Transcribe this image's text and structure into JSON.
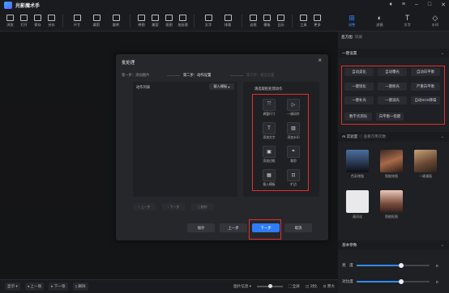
{
  "app": {
    "title": "光影魔术手"
  },
  "toolbar": {
    "items": [
      {
        "icon": "browse-icon",
        "label": "浏览"
      },
      {
        "icon": "open-icon",
        "label": "打开"
      },
      {
        "icon": "save-icon",
        "label": "保存"
      },
      {
        "icon": "save-as-icon",
        "label": "另存"
      },
      {
        "icon": "size-icon",
        "label": "尺寸"
      },
      {
        "icon": "crop-icon",
        "label": "裁剪"
      },
      {
        "icon": "rotate-icon",
        "label": "旋转"
      },
      {
        "icon": "puzzle-icon",
        "label": "拼图"
      },
      {
        "icon": "beauty-icon",
        "label": "美容"
      },
      {
        "icon": "cutout-icon",
        "label": "抠图"
      },
      {
        "icon": "batch-icon",
        "label": "批处理"
      },
      {
        "icon": "text-icon",
        "label": "文字"
      },
      {
        "icon": "layout-icon",
        "label": "排版"
      },
      {
        "icon": "border-icon",
        "label": "边框"
      },
      {
        "icon": "template-icon",
        "label": "模板"
      },
      {
        "icon": "calendar-icon",
        "label": "日历"
      },
      {
        "icon": "tools-icon",
        "label": "工具"
      },
      {
        "icon": "more-icon",
        "label": "更多"
      }
    ]
  },
  "right_tabs": [
    {
      "icon": "adjust-icon",
      "label": "调整",
      "active": true
    },
    {
      "icon": "filter-icon",
      "label": "滤镜",
      "active": false
    },
    {
      "icon": "text-icon",
      "label": "文字",
      "active": false
    },
    {
      "icon": "watermark-icon",
      "label": "水印",
      "active": false
    }
  ],
  "right_panel": {
    "header": "直方图",
    "header_sub": "隐藏",
    "quick_title": "一键设置",
    "quick_buttons": [
      "自动美化",
      "自动曝光",
      "自动白平衡",
      "一键锐化",
      "一键抠光",
      "严重白平衡",
      "一键补光",
      "一键减光",
      "自动SOS降噪",
      "数字点测光",
      "白平衡一指键"
    ],
    "ai_title": "AI 实验室",
    "ai_sub": "查看可用次数",
    "ai_items": [
      "色彩增强",
      "智能修图",
      "一键漫画",
      "画风化",
      "智能抠图"
    ],
    "basic_title": "基本参数",
    "sliders": [
      {
        "label": "亮　度",
        "value": "0",
        "level": 0.5
      },
      {
        "label": "对比度",
        "value": "0",
        "level": 0.5
      }
    ]
  },
  "dialog": {
    "title": "批处理",
    "close": "×",
    "steps": [
      "第一步：添加图片",
      "第二步：动作设置",
      "第三步：输出设置"
    ],
    "active_step": 1,
    "list_label": "动作列表",
    "import_select": "载入模板",
    "list_buttons": [
      "上一步",
      "下一步",
      "删除"
    ],
    "actions_caption": "请选取批处理动作",
    "actions": [
      {
        "icon": "resize-icon",
        "glyph": "⤧",
        "label": "调整尺寸"
      },
      {
        "icon": "play-icon",
        "glyph": "▷",
        "label": "一键动作"
      },
      {
        "icon": "text-t-icon",
        "glyph": "T",
        "label": "添加文字"
      },
      {
        "icon": "image-icon",
        "glyph": "▨",
        "label": "添加水印"
      },
      {
        "icon": "frame-icon",
        "glyph": "▣",
        "label": "添加边框"
      },
      {
        "icon": "crop-icon",
        "glyph": "⌗",
        "label": "裁剪"
      },
      {
        "icon": "insert-template-icon",
        "glyph": "▦",
        "label": "插入模板"
      },
      {
        "icon": "expand-icon",
        "glyph": "⊡",
        "label": "扩边"
      }
    ],
    "footer": {
      "save": "保存",
      "prev": "上一步",
      "next": "下一步",
      "cancel": "取消"
    }
  },
  "bottombar": {
    "open": "显示",
    "prev": "上一张",
    "next": "下一张",
    "delete": "删除",
    "image_info": "图片信息",
    "fit": "全屏",
    "compare": "对比",
    "original": "原大"
  }
}
